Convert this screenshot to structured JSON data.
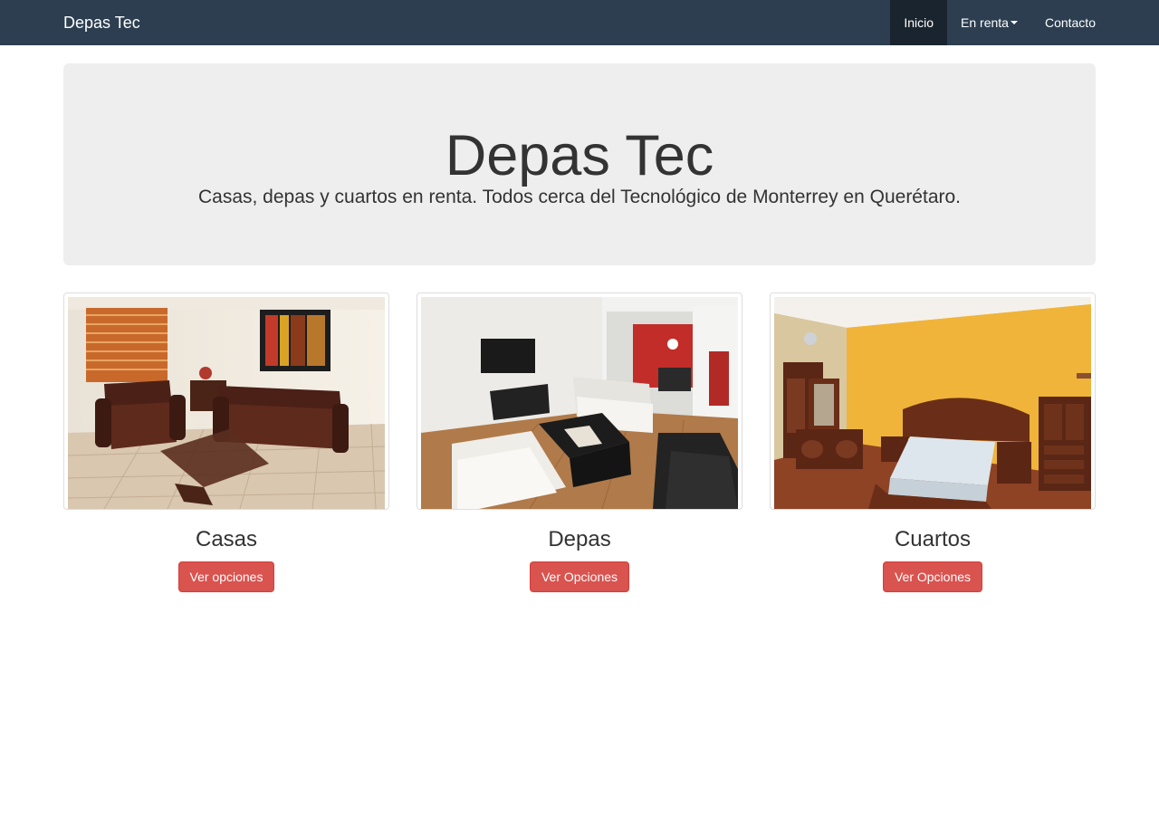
{
  "navbar": {
    "brand": "Depas Tec",
    "items": [
      {
        "label": "Inicio",
        "active": true
      },
      {
        "label": "En renta",
        "dropdown": true
      },
      {
        "label": "Contacto"
      }
    ]
  },
  "hero": {
    "title": "Depas Tec",
    "subtitle": "Casas, depas y cuartos en renta. Todos cerca del Tecnológico de Monterrey en Querétaro."
  },
  "cards": [
    {
      "title": "Casas",
      "button": "Ver opciones"
    },
    {
      "title": "Depas",
      "button": "Ver Opciones"
    },
    {
      "title": "Cuartos",
      "button": "Ver Opciones"
    }
  ],
  "colors": {
    "navbar": "#2c3e50",
    "navbar_active": "#1a242f",
    "hero_bg": "#eeeeee",
    "button": "#d9534f"
  }
}
